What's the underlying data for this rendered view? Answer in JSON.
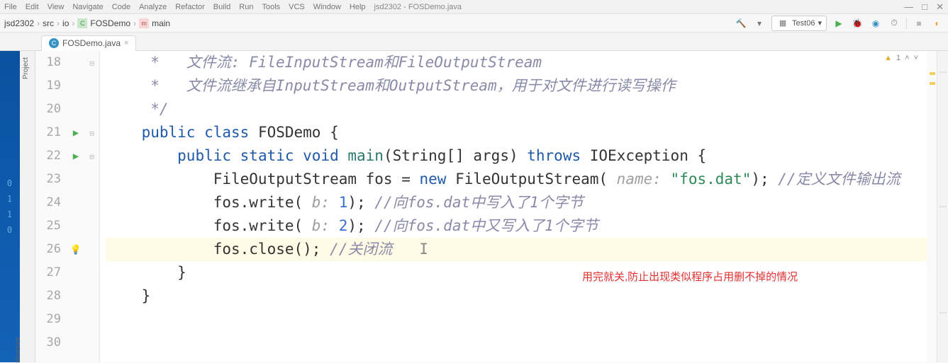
{
  "menu": {
    "items": [
      "File",
      "Edit",
      "View",
      "Navigate",
      "Code",
      "Analyze",
      "Refactor",
      "Build",
      "Run",
      "Tools",
      "VCS",
      "Window",
      "Help"
    ],
    "window_title": "jsd2302 - FOSDemo.java"
  },
  "breadcrumbs": {
    "items": [
      "jsd2302",
      "src",
      "io",
      "FOSDemo",
      "main"
    ]
  },
  "run_config": {
    "label": "Test06"
  },
  "tabs": {
    "active": "FOSDemo.java"
  },
  "project_tool": "Project",
  "structure_tool": "Structure",
  "left_stripe": [
    "0",
    "1",
    "1",
    "0"
  ],
  "warnings": {
    "count": "1"
  },
  "gutter": {
    "start": 18,
    "end": 30,
    "run_icons": [
      21,
      22
    ],
    "bulb_icons": [
      26
    ],
    "fold_open": [
      21,
      22
    ],
    "fold_minus": [
      18
    ]
  },
  "annotation": "用完就关,防止出现类似程序占用删不掉的情况",
  "code_lines": {
    "l18": {
      "indent": "     ",
      "tokens": [
        {
          "t": "*   ",
          "c": "cm"
        },
        {
          "t": "文件流: FileInputStream和FileOutputStream",
          "c": "cm-cn"
        }
      ]
    },
    "l19": {
      "indent": "     ",
      "tokens": [
        {
          "t": "*   ",
          "c": "cm"
        },
        {
          "t": "文件流继承自InputStream和OutputStream，用于对文件进行读写操作",
          "c": "cm-cn"
        }
      ]
    },
    "l20": {
      "indent": "     ",
      "tokens": [
        {
          "t": "*/",
          "c": "cm"
        }
      ]
    },
    "l21": {
      "indent": "    ",
      "tokens": [
        {
          "t": "public class ",
          "c": "kw"
        },
        {
          "t": "FOSDemo {",
          "c": ""
        }
      ]
    },
    "l22": {
      "indent": "        ",
      "tokens": [
        {
          "t": "public static void ",
          "c": "kw"
        },
        {
          "t": "main",
          "c": "fn"
        },
        {
          "t": "(String[] args) ",
          "c": ""
        },
        {
          "t": "throws ",
          "c": "kw"
        },
        {
          "t": "IOException {",
          "c": ""
        }
      ]
    },
    "l23": {
      "indent": "            ",
      "tokens": [
        {
          "t": "FileOutputStream fos = ",
          "c": ""
        },
        {
          "t": "new ",
          "c": "kw"
        },
        {
          "t": "FileOutputStream(",
          "c": ""
        },
        {
          "t": " name: ",
          "c": "hint"
        },
        {
          "t": "\"fos.dat\"",
          "c": "str"
        },
        {
          "t": "); ",
          "c": ""
        },
        {
          "t": "//定义文件输出流",
          "c": "cm-cn"
        }
      ]
    },
    "l24": {
      "indent": "            ",
      "tokens": [
        {
          "t": "fos.write(",
          "c": ""
        },
        {
          "t": " b: ",
          "c": "hint"
        },
        {
          "t": "1",
          "c": "num"
        },
        {
          "t": "); ",
          "c": ""
        },
        {
          "t": "//向fos.dat中写入了1个字节",
          "c": "cm-cn"
        }
      ]
    },
    "l25": {
      "indent": "            ",
      "tokens": [
        {
          "t": "fos.write(",
          "c": ""
        },
        {
          "t": " b: ",
          "c": "hint"
        },
        {
          "t": "2",
          "c": "num"
        },
        {
          "t": "); ",
          "c": ""
        },
        {
          "t": "//向fos.dat中又写入了1个字节",
          "c": "cm-cn"
        }
      ]
    },
    "l26": {
      "indent": "            ",
      "tokens": [
        {
          "t": "fos.close(); ",
          "c": ""
        },
        {
          "t": "//关闭流",
          "c": "cm-cn"
        },
        {
          "t": "   I",
          "c": "cursor-caret"
        }
      ],
      "hl": true
    },
    "l27": {
      "indent": "        ",
      "tokens": [
        {
          "t": "}",
          "c": ""
        }
      ]
    },
    "l28": {
      "indent": "    ",
      "tokens": [
        {
          "t": "}",
          "c": ""
        }
      ]
    },
    "l29": {
      "indent": "",
      "tokens": [
        {
          "t": "",
          "c": ""
        }
      ]
    },
    "l30": {
      "indent": "",
      "tokens": [
        {
          "t": "",
          "c": ""
        }
      ]
    }
  }
}
